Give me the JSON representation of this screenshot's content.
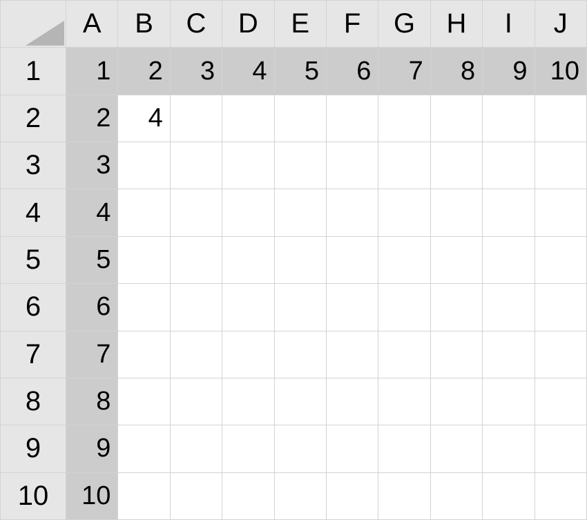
{
  "columns": [
    "A",
    "B",
    "C",
    "D",
    "E",
    "F",
    "G",
    "H",
    "I",
    "J"
  ],
  "rows": [
    "1",
    "2",
    "3",
    "4",
    "5",
    "6",
    "7",
    "8",
    "9",
    "10"
  ],
  "cells": {
    "A1": "1",
    "B1": "2",
    "C1": "3",
    "D1": "4",
    "E1": "5",
    "F1": "6",
    "G1": "7",
    "H1": "8",
    "I1": "9",
    "J1": "10",
    "A2": "2",
    "B2": "4",
    "C2": "",
    "D2": "",
    "E2": "",
    "F2": "",
    "G2": "",
    "H2": "",
    "I2": "",
    "J2": "",
    "A3": "3",
    "B3": "",
    "C3": "",
    "D3": "",
    "E3": "",
    "F3": "",
    "G3": "",
    "H3": "",
    "I3": "",
    "J3": "",
    "A4": "4",
    "B4": "",
    "C4": "",
    "D4": "",
    "E4": "",
    "F4": "",
    "G4": "",
    "H4": "",
    "I4": "",
    "J4": "",
    "A5": "5",
    "B5": "",
    "C5": "",
    "D5": "",
    "E5": "",
    "F5": "",
    "G5": "",
    "H5": "",
    "I5": "",
    "J5": "",
    "A6": "6",
    "B6": "",
    "C6": "",
    "D6": "",
    "E6": "",
    "F6": "",
    "G6": "",
    "H6": "",
    "I6": "",
    "J6": "",
    "A7": "7",
    "B7": "",
    "C7": "",
    "D7": "",
    "E7": "",
    "F7": "",
    "G7": "",
    "H7": "",
    "I7": "",
    "J7": "",
    "A8": "8",
    "B8": "",
    "C8": "",
    "D8": "",
    "E8": "",
    "F8": "",
    "G8": "",
    "H8": "",
    "I8": "",
    "J8": "",
    "A9": "9",
    "B9": "",
    "C9": "",
    "D9": "",
    "E9": "",
    "F9": "",
    "G9": "",
    "H9": "",
    "I9": "",
    "J9": "",
    "A10": "10",
    "B10": "",
    "C10": "",
    "D10": "",
    "E10": "",
    "F10": "",
    "G10": "",
    "H10": "",
    "I10": "",
    "J10": ""
  },
  "shaded": [
    "A1",
    "B1",
    "C1",
    "D1",
    "E1",
    "F1",
    "G1",
    "H1",
    "I1",
    "J1",
    "A2",
    "A3",
    "A4",
    "A5",
    "A6",
    "A7",
    "A8",
    "A9",
    "A10"
  ]
}
